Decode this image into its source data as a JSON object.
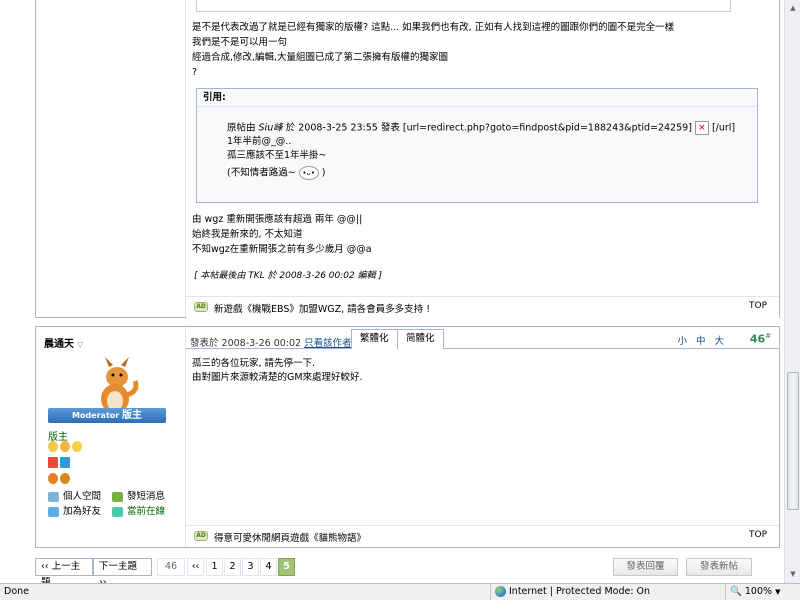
{
  "post1": {
    "body_lines": [
      "是不是代表改過了就是已經有獨家的版權? 這點... 如果我們也有改, 正如有人找到這裡的圖跟你們的圖不是完全一樣",
      "我們是不是可以用一句",
      "經過合成,修改,編輯,大量組圖已成了第二張擁有版權的獨家圖",
      "?"
    ],
    "quote_title": "引用:",
    "quote_lines": {
      "line1_prefix": "原帖由 ",
      "line1_author": "Siu峰",
      "line1_mid": " 於 2008-3-25 23:55 發表 [url=redirect.php?goto=findpost&pid=188243&ptid=24259]",
      "line1_suffix": " [/url]",
      "line2": "1年半前@_@..",
      "line3": "孤三應該不至1年半掛~",
      "line4_prefix": "(不知情者路過~ ",
      "line4_suffix": " )"
    },
    "reply_lines": [
      "由 wgz 重新開張應該有超過 兩年 @@||",
      "始終我是新來的, 不太知道",
      "不知wgz在重新開張之前有多少歲月 @@a"
    ],
    "edited_note": "[ 本帖最後由 TKL 於 2008-3-26 00:02 編輯 ]",
    "footer_ad": "新遊戲《機戰EBS》加盟WGZ, 請各會員多多支持 !",
    "top_label": "TOP"
  },
  "post2": {
    "author": "晨通天",
    "badge_prefix": "Moderator",
    "badge_title": "版主",
    "rank": "版主",
    "actions": {
      "space": "個人空間",
      "pm": "發短消息",
      "friend": "加為好友",
      "online": "當前在線"
    },
    "meta_prefix": "發表於 2008-3-26 00:02",
    "meta_link": "只看該作者",
    "tab_trad": "繁體化",
    "tab_simp": "简體化",
    "font_size": "小 中 大",
    "floor": "46",
    "floor_suffix": "#",
    "body_lines": [
      "孤三的各位玩家, 請先停一下.",
      "由對圖片來源較清楚的GM來處理好較好."
    ],
    "footer_ad": "得意可愛休閒網頁遊戲《貓熊物語》",
    "top_label": "TOP"
  },
  "pager": {
    "prev": "‹‹ 上一主題",
    "next": "下一主題 ››",
    "total": "46",
    "first": "‹‹",
    "pages": [
      "1",
      "2",
      "3",
      "4",
      "5"
    ],
    "current": "5"
  },
  "buttons": {
    "reply": "發表回覆",
    "new_post": "發表新帖"
  },
  "statusbar": {
    "status": "Done",
    "zone": "Internet | Protected Mode: On",
    "zoom": "100%"
  }
}
